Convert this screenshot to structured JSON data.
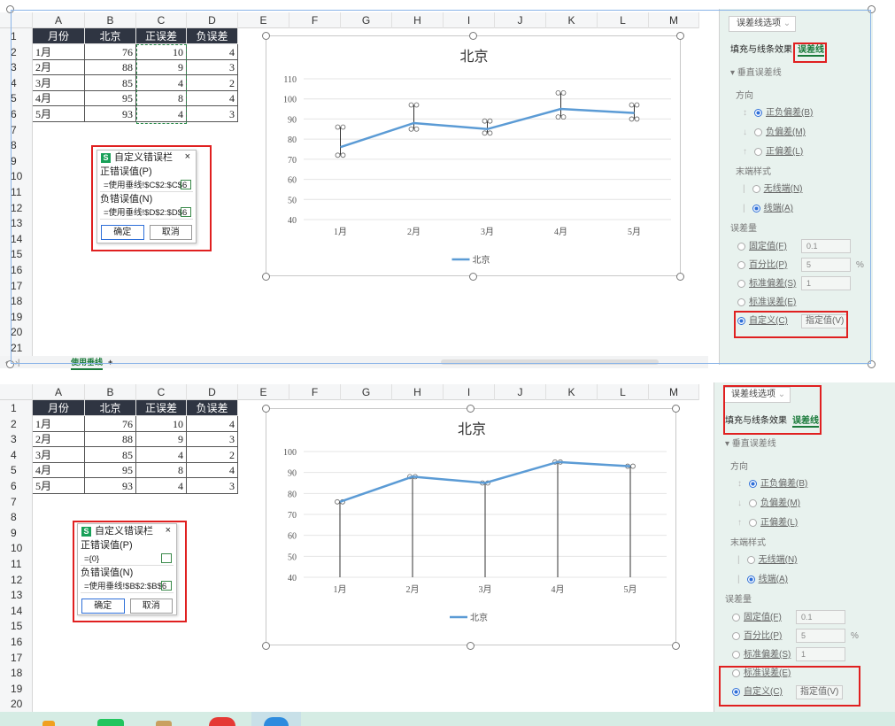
{
  "columns": [
    "A",
    "B",
    "C",
    "D",
    "E",
    "F",
    "G",
    "H",
    "I",
    "J",
    "K",
    "L",
    "M"
  ],
  "rows": [
    "1",
    "2",
    "3",
    "4",
    "5",
    "6",
    "7",
    "8",
    "9",
    "10",
    "11",
    "12",
    "13",
    "14",
    "15",
    "16",
    "17",
    "18",
    "19",
    "20",
    "21"
  ],
  "table": {
    "headers": [
      "月份",
      "北京",
      "正误差",
      "负误差"
    ],
    "data": [
      [
        "1月",
        "76",
        "10",
        "4"
      ],
      [
        "2月",
        "88",
        "9",
        "3"
      ],
      [
        "3月",
        "85",
        "4",
        "2"
      ],
      [
        "4月",
        "95",
        "8",
        "4"
      ],
      [
        "5月",
        "93",
        "4",
        "3"
      ]
    ]
  },
  "chart_data": [
    {
      "type": "line",
      "title": "北京",
      "categories": [
        "1月",
        "2月",
        "3月",
        "4月",
        "5月"
      ],
      "series": [
        {
          "name": "北京",
          "values": [
            76,
            88,
            85,
            95,
            93
          ]
        }
      ],
      "error_plus": [
        10,
        9,
        4,
        8,
        4
      ],
      "error_minus": [
        4,
        3,
        2,
        4,
        3
      ],
      "ylim": [
        40,
        110
      ],
      "yticks": [
        "40",
        "50",
        "60",
        "70",
        "80",
        "90",
        "100",
        "110"
      ],
      "legend": "bottom",
      "grid": true
    },
    {
      "type": "line",
      "title": "北京",
      "categories": [
        "1月",
        "2月",
        "3月",
        "4月",
        "5月"
      ],
      "series": [
        {
          "name": "北京",
          "values": [
            76,
            88,
            85,
            95,
            93
          ]
        }
      ],
      "error_plus": [
        0,
        0,
        0,
        0,
        0
      ],
      "error_minus_to": 40,
      "ylim": [
        40,
        100
      ],
      "yticks": [
        "40",
        "50",
        "60",
        "70",
        "80",
        "90",
        "100"
      ],
      "legend": "bottom",
      "grid": true
    }
  ],
  "dialog1": {
    "logo": "S",
    "title": "自定义错误栏",
    "close": "×",
    "plus_label": "正错误值(P)",
    "plus_value": "=使用垂线!$C$2:$C$6",
    "minus_label": "负错误值(N)",
    "minus_value": "=使用垂线!$D$2:$D$6",
    "ok": "确定",
    "cancel": "取消"
  },
  "dialog2": {
    "logo": "S",
    "title": "自定义错误栏",
    "close": "×",
    "plus_label": "正错误值(P)",
    "plus_value": "={0}",
    "minus_label": "负错误值(N)",
    "minus_value": "=使用垂线!$B$2:$B$6",
    "ok": "确定",
    "cancel": "取消"
  },
  "sidebar": {
    "dropdown": "误差线选项",
    "tabs": [
      "填充与线条",
      "效果",
      "误差线"
    ],
    "section": "▾ 垂直误差线",
    "direction_label": "方向",
    "direction_options": [
      "正负偏差(B)",
      "负偏差(M)",
      "正偏差(L)"
    ],
    "end_label": "末端样式",
    "end_options": [
      "无线端(N)",
      "线端(A)"
    ],
    "amount_label": "误差量",
    "amount_options": [
      "固定值(F)",
      "百分比(P)",
      "标准偏差(S)",
      "标准误差(E)",
      "自定义(C)"
    ],
    "fixed_value": "0.1",
    "percent_value": "5",
    "percent_unit": "%",
    "std_value": "1",
    "specify_button": "指定值(V)"
  },
  "sheet_tab": "使用垂线",
  "add_sheet": "+",
  "nav_arrows": "‹ › ›|"
}
